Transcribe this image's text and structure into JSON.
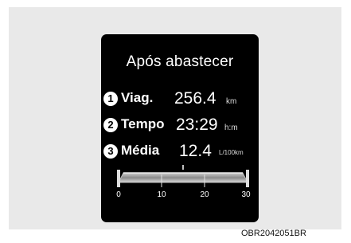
{
  "display": {
    "title": "Após abastecer",
    "rows": [
      {
        "number": "1",
        "label": "Viag.",
        "value": "256.4",
        "unit": "km"
      },
      {
        "number": "2",
        "label": "Tempo",
        "value": "23:29",
        "unit": "h:m"
      },
      {
        "number": "3",
        "label": "Média",
        "value": "12.4",
        "unit": "L/100km"
      }
    ],
    "gauge": {
      "scale_labels": [
        "0",
        "10",
        "20",
        "30"
      ],
      "scale_min": 0,
      "scale_max": 30,
      "current_value": 12.4
    }
  },
  "caption": "OBR2042051BR"
}
